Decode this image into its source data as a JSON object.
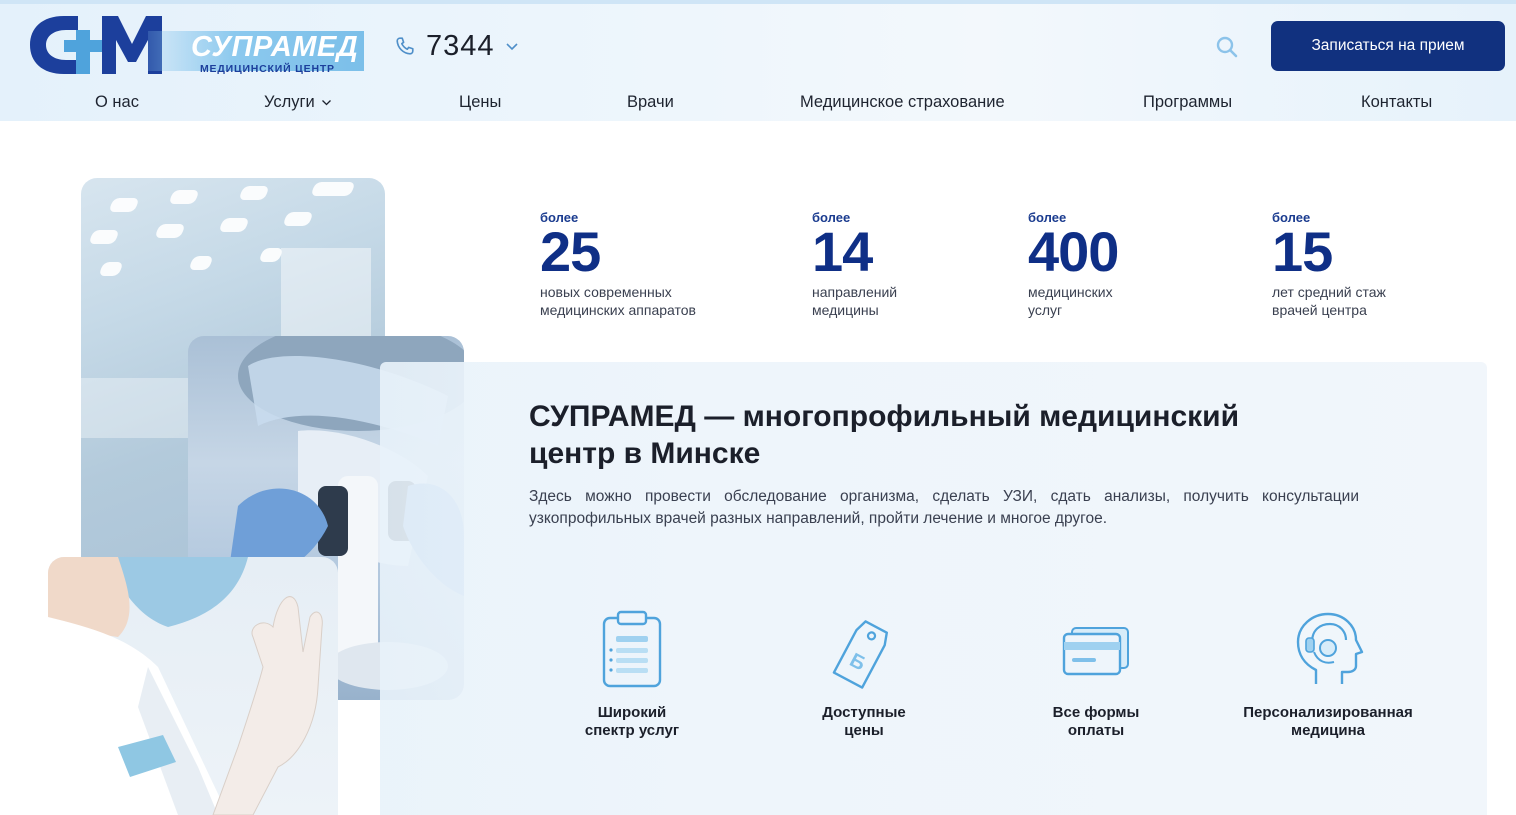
{
  "brand": {
    "name": "СУПРАМЕД",
    "subtitle": "МЕДИЦИНСКИЙ ЦЕНТР",
    "colors": {
      "primary": "#11317f",
      "accent": "#4fa3dc",
      "light_blue": "#8cc9ee"
    }
  },
  "header": {
    "phone": "7344",
    "search_icon": "search-icon",
    "cta_label": "Записаться на прием"
  },
  "nav": {
    "items": [
      {
        "label": "О нас"
      },
      {
        "label": "Услуги",
        "has_dropdown": true
      },
      {
        "label": "Цены"
      },
      {
        "label": "Врачи"
      },
      {
        "label": "Медицинское страхование"
      },
      {
        "label": "Программы"
      },
      {
        "label": "Контакты"
      }
    ]
  },
  "stats": [
    {
      "prefix": "более",
      "value": "25",
      "description": "новых современных\nмедицинских аппаратов"
    },
    {
      "prefix": "более",
      "value": "14",
      "description": "направлений\nмедицины"
    },
    {
      "prefix": "более",
      "value": "400",
      "description": "медицинских\nуслуг"
    },
    {
      "prefix": "более",
      "value": "15",
      "description": "лет средний стаж\nврачей центра"
    }
  ],
  "about": {
    "headline": "СУПРАМЕД — многопрофильный медицинский центр в  Минске",
    "text": "Здесь можно провести обследование организма, сделать УЗИ, сдать анализы, получить консультации узкопрофильных врачей разных направлений, пройти лечение и многое другое."
  },
  "features": [
    {
      "icon": "clipboard-icon",
      "label": "Широкий\nспектр услуг"
    },
    {
      "icon": "price-tag-icon",
      "label": "Доступные\nцены"
    },
    {
      "icon": "credit-card-icon",
      "label": "Все формы\nоплаты"
    },
    {
      "icon": "head-headset-icon",
      "label": "Персонализированная\nмедицина"
    }
  ]
}
